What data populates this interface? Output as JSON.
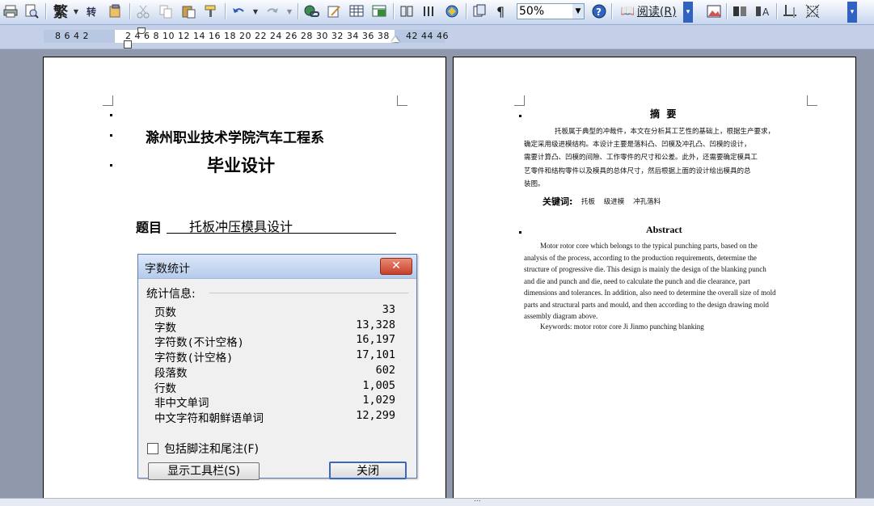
{
  "toolbar": {
    "trad_char": "繁",
    "zoom_value": "50%",
    "read_label": "阅读(R)"
  },
  "ruler": {
    "left_numbers": "8  6  4  2",
    "main_numbers": "2  4  6  8  10  12  14  16  18  20  22  24  26  28  30  32  34  36  38",
    "right_numbers": "42  44  46"
  },
  "page_left": {
    "institute": "滁州职业技术学院汽车工程系",
    "design_title": "毕业设计",
    "topic_label": "题目",
    "topic_value": "托板冲压模具设计"
  },
  "page_right": {
    "abstract_cn_title": "摘  要",
    "abstract_cn_lines": [
      "托板属于典型的冲裁件，本文在分析其工艺性的基础上，根据生产要求，",
      "确定采用级进模结构。本设计主要是落料凸、凹模及冲孔凸、凹模的设计，",
      "需要计算凸、凹模的间隙、工作零件的尺寸和公差。此外，还需要确定模具工",
      "艺零件和结构零件以及模具的总体尺寸，然后根据上面的设计绘出模具的总",
      "装图。"
    ],
    "keywords_cn_label": "关键词:",
    "keywords_cn_value": "托板    级进模    冲孔落料",
    "abstract_en_title": "Abstract",
    "abstract_en_lines": [
      "Motor rotor core which belongs to the typical punching parts, based on the",
      "analysis of the process, according to the production requirements, determine the",
      "structure of progressive die. This design is mainly the design of the blanking punch",
      "and die and punch and die, need to calculate the punch and die clearance, part",
      "dimensions and tolerances. In addition, also need to determine the overall size of mold",
      "parts and structural parts and mould, and then according to the design drawing mold",
      "assembly diagram above."
    ],
    "keywords_en": "Keywords: motor rotor core Ji Jinmo punching blanking"
  },
  "dialog": {
    "title": "字数统计",
    "section": "统计信息:",
    "stats": [
      {
        "label": "页数",
        "value": "33"
      },
      {
        "label": "字数",
        "value": "13,328"
      },
      {
        "label": "字符数(不计空格)",
        "value": "16,197"
      },
      {
        "label": "字符数(计空格)",
        "value": "17,101"
      },
      {
        "label": "段落数",
        "value": "602"
      },
      {
        "label": "行数",
        "value": "1,005"
      },
      {
        "label": "非中文单词",
        "value": "1,029"
      },
      {
        "label": "中文字符和朝鲜语单词",
        "value": "12,299"
      }
    ],
    "checkbox_label": "包括脚注和尾注(F)",
    "show_toolbar_label": "显示工具栏(S)",
    "close_label": "关闭"
  },
  "statusbar": {
    "grip": "..."
  }
}
